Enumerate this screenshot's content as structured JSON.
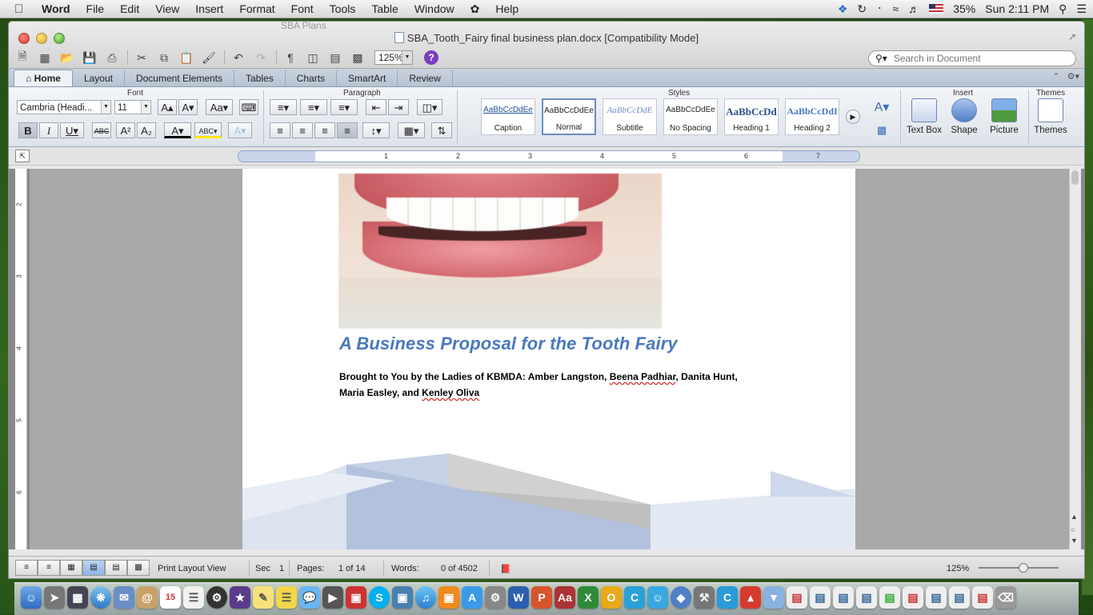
{
  "menubar": {
    "app": "Word",
    "items": [
      "File",
      "Edit",
      "View",
      "Insert",
      "Format",
      "Font",
      "Tools",
      "Table",
      "Window",
      "Help"
    ],
    "battery": "35%",
    "clock": "Sun 2:11 PM"
  },
  "window": {
    "background_title": "SBA Plans",
    "title": "SBA_Tooth_Fairy final business plan.docx [Compatibility Mode]",
    "zoom": "125%",
    "search_placeholder": "Search in Document"
  },
  "ribbon": {
    "tabs": [
      "Home",
      "Layout",
      "Document Elements",
      "Tables",
      "Charts",
      "SmartArt",
      "Review"
    ],
    "active_tab": "Home",
    "groups": {
      "font": "Font",
      "paragraph": "Paragraph",
      "styles": "Styles",
      "insert": "Insert",
      "themes": "Themes"
    },
    "font_name": "Cambria (Headi...",
    "font_size": "11",
    "styles": [
      {
        "sample": "AaBbCcDdEe",
        "name": "Caption"
      },
      {
        "sample": "AaBbCcDdEe",
        "name": "Normal"
      },
      {
        "sample": "AaBbCcDdE",
        "name": "Subtitle"
      },
      {
        "sample": "AaBbCcDdEe",
        "name": "No Spacing"
      },
      {
        "sample": "AaBbCcDd",
        "name": "Heading 1"
      },
      {
        "sample": "AaBbCcDdI",
        "name": "Heading 2"
      }
    ],
    "insert_buttons": [
      "Text Box",
      "Shape",
      "Picture"
    ],
    "themes_button": "Themes"
  },
  "ruler": {
    "numbers": [
      "1",
      "2",
      "3",
      "4",
      "5",
      "6",
      "7"
    ],
    "vnumbers": [
      "2",
      "3",
      "4",
      "5",
      "6"
    ]
  },
  "document": {
    "title": "A Business Proposal for the Tooth Fairy",
    "byline_1": "Brought to You by the Ladies of KBMDA: Amber Langston, ",
    "byline_sp1": "Beena Padhiar",
    "byline_2": ", Danita Hunt,",
    "byline_3": "Maria Easley, and ",
    "byline_sp2": "Kenley Oliva"
  },
  "status": {
    "view": "Print Layout View",
    "sec_label": "Sec",
    "sec_value": "1",
    "pages_label": "Pages:",
    "pages_value": "1 of 14",
    "words_label": "Words:",
    "words_value": "0 of 4502",
    "zoom": "125%"
  },
  "colors": {
    "title_blue": "#4a78bf",
    "ribbon_tab_bg": "#c9d3e0"
  }
}
